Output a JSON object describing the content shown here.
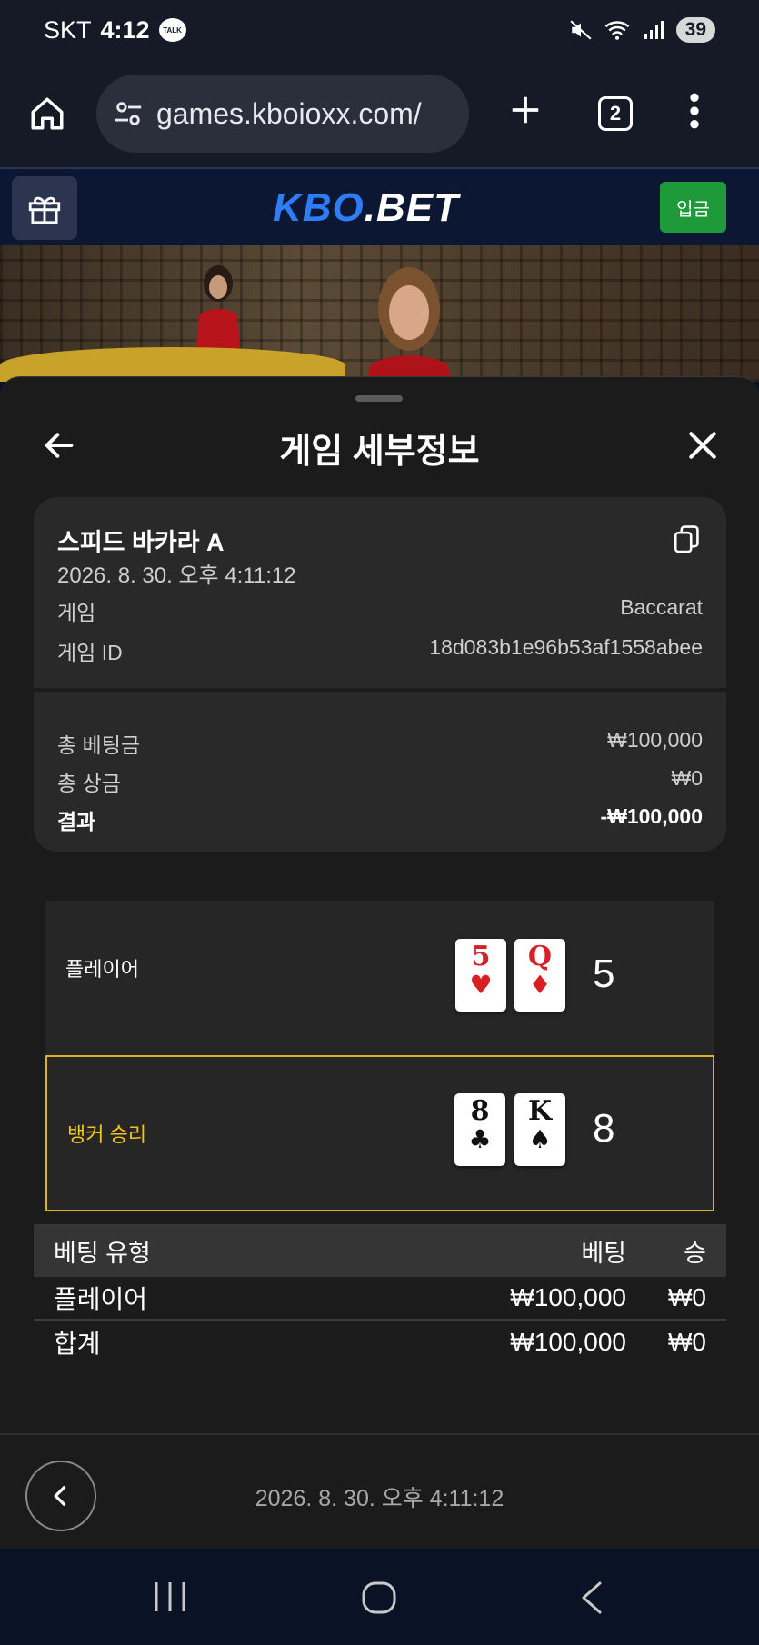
{
  "status_bar": {
    "carrier": "SKT",
    "time": "4:12",
    "talk_badge": "TALK",
    "battery": "39",
    "icons": [
      "mute-icon",
      "wifi-icon",
      "signal-icon"
    ]
  },
  "browser": {
    "url": "games.kboioxx.com/",
    "tab_count": "2"
  },
  "site_header": {
    "logo_part1": "KBO",
    "logo_part2": ".BET",
    "deposit_label": "입금"
  },
  "sheet": {
    "title": "게임 세부정보",
    "game_name": "스피드 바카라 A",
    "game_date": "2026. 8. 30. 오후 4:11:12",
    "rows": [
      {
        "label": "게임",
        "value": "Baccarat"
      },
      {
        "label": "게임 ID",
        "value": "18d083b1e96b53af1558abee"
      }
    ],
    "summary": [
      {
        "label": "총 베팅금",
        "value": "₩100,000"
      },
      {
        "label": "총 상금",
        "value": "₩0"
      },
      {
        "label": "결과",
        "value": "-₩100,000"
      }
    ],
    "player": {
      "label": "플레이어",
      "cards": [
        {
          "rank": "5",
          "suit": "♥",
          "color": "#d81f26"
        },
        {
          "rank": "Q",
          "suit": "♦",
          "color": "#d81f26"
        }
      ],
      "score": "5"
    },
    "banker": {
      "label": "뱅커 승리",
      "cards": [
        {
          "rank": "8",
          "suit": "♣",
          "color": "#111111"
        },
        {
          "rank": "K",
          "suit": "♠",
          "color": "#111111"
        }
      ],
      "score": "8"
    },
    "bet_table": {
      "headers": [
        "베팅 유형",
        "베팅",
        "승"
      ],
      "rows": [
        {
          "type": "플레이어",
          "bet": "₩100,000",
          "win": "₩0"
        }
      ],
      "total": {
        "type": "합계",
        "bet": "₩100,000",
        "win": "₩0"
      }
    },
    "footer_date": "2026. 8. 30. 오후 4:11:12"
  },
  "colors": {
    "accent_win": "#f0c419",
    "deposit_green": "#1f9a3a",
    "logo_blue": "#2e7cf6"
  }
}
